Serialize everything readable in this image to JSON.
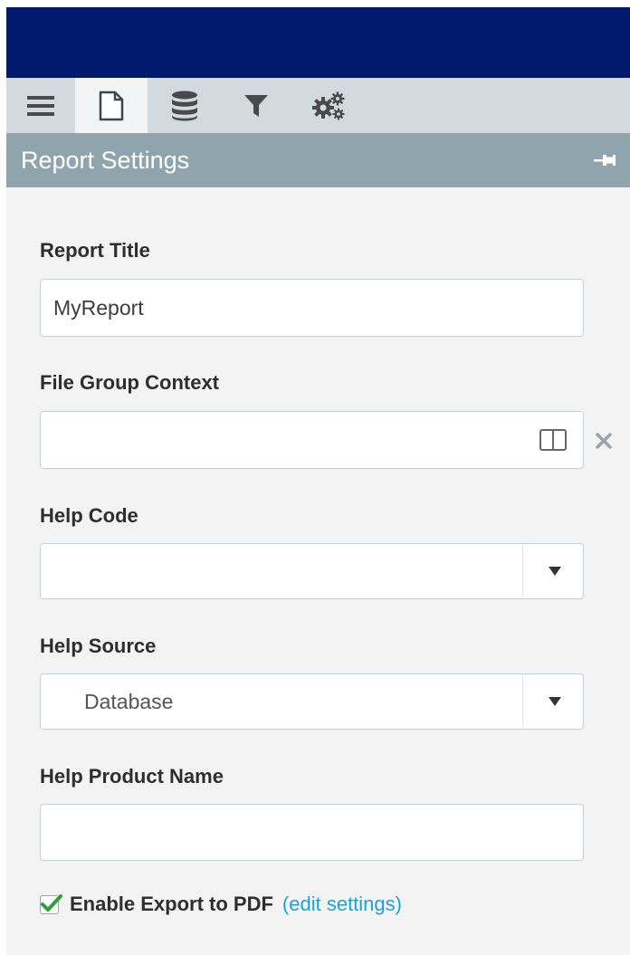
{
  "toolbar": {
    "buttons": [
      {
        "icon": "menu-icon",
        "active": false
      },
      {
        "icon": "document-icon",
        "active": true
      },
      {
        "icon": "database-icon",
        "active": false
      },
      {
        "icon": "filter-icon",
        "active": false
      },
      {
        "icon": "gears-icon",
        "active": false
      }
    ]
  },
  "panel": {
    "title": "Report Settings"
  },
  "form": {
    "report_title": {
      "label": "Report Title",
      "value": "MyReport"
    },
    "file_group_context": {
      "label": "File Group Context",
      "value": ""
    },
    "help_code": {
      "label": "Help Code",
      "value": ""
    },
    "help_source": {
      "label": "Help Source",
      "value": "Database"
    },
    "help_product_name": {
      "label": "Help Product Name",
      "value": ""
    },
    "export_pdf": {
      "label": "Enable Export to PDF",
      "checked": true,
      "link": "(edit settings)"
    }
  },
  "colors": {
    "topbar": "#001a6e",
    "toolbar": "#d3dadf",
    "header": "#8fa4ad",
    "link": "#1aa4d6",
    "check": "#2e9e3a"
  }
}
